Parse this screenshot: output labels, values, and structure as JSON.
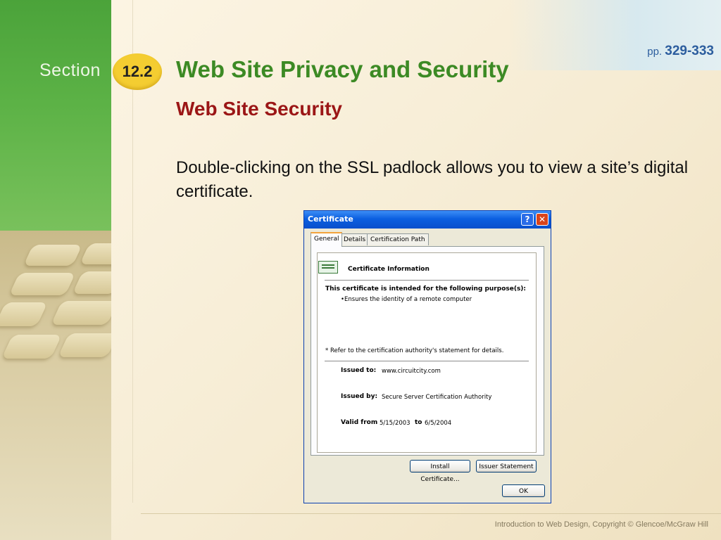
{
  "slide": {
    "section_label": "Section",
    "section_number": "12.2",
    "pages_prefix": "pp.",
    "pages_range": "329-333",
    "title": "Web Site Privacy and Security",
    "subtitle": "Web Site Security",
    "body": "Double-clicking on the SSL padlock allows you to view a site’s digital certificate.",
    "footer": "Introduction to Web Design, Copyright © Glencoe/McGraw Hill"
  },
  "dialog": {
    "title": "Certificate",
    "help_glyph": "?",
    "close_glyph": "✕",
    "tabs": [
      "General",
      "Details",
      "Certification Path"
    ],
    "heading": "Certificate Information",
    "purpose_heading": "This certificate is intended for the following purpose(s):",
    "purpose_item": "•Ensures the identity of a remote computer",
    "note": "* Refer to the certification authority's statement for details.",
    "issued_to_label": "Issued to:",
    "issued_to_value": "www.circuitcity.com",
    "issued_by_label": "Issued by:",
    "issued_by_value": "Secure Server Certification Authority",
    "valid_from_label": "Valid from",
    "valid_from_value": "5/15/2003",
    "valid_to_label": "to",
    "valid_to_value": "6/5/2004",
    "install_button": "Install Certificate...",
    "issuer_button": "Issuer Statement",
    "ok_button": "OK"
  },
  "colors": {
    "sidebar_green": "#4ba33a",
    "title_green": "#3c8a24",
    "subtitle_red": "#9b1616",
    "badge_yellow": "#f4cd31",
    "pages_blue": "#2c5d9e",
    "xp_titlebar_blue": "#0b5fe0"
  }
}
